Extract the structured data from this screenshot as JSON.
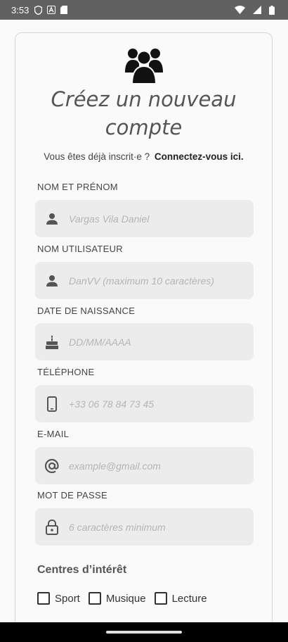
{
  "status_bar": {
    "time": "3:53",
    "icons_left": [
      "shield-icon",
      "a-icon",
      "sd-card-icon"
    ],
    "icons_right": [
      "wifi-icon",
      "signal-icon",
      "battery-icon"
    ]
  },
  "header": {
    "title": "Créez un nouveau compte",
    "subtitle": "Vous êtes déjà inscrit·e ?",
    "login_link": "Connectez-vous ici."
  },
  "fields": {
    "fullname": {
      "label": "NOM ET PRÉNOM",
      "placeholder": "Vargas Vila Daniel",
      "icon": "person-icon"
    },
    "username": {
      "label": "NOM UTILISATEUR",
      "placeholder": "DanVV (maximum 10 caractères)",
      "icon": "person-icon"
    },
    "birthdate": {
      "label": "DATE DE NAISSANCE",
      "placeholder": "DD/MM/AAAA",
      "icon": "cake-icon"
    },
    "phone": {
      "label": "TÉLÉPHONE",
      "placeholder": "+33 06 78 84 73 45",
      "icon": "phone-icon"
    },
    "email": {
      "label": "E-MAIL",
      "placeholder": "example@gmail.com",
      "icon": "at-icon"
    },
    "password": {
      "label": "MOT DE PASSE",
      "placeholder": "6 caractères minimum",
      "icon": "lock-icon"
    }
  },
  "interests": {
    "title": "Centres d’intérêt",
    "options": [
      "Sport",
      "Musique",
      "Lecture"
    ]
  },
  "colors": {
    "field_bg": "#ececec",
    "placeholder": "#b5b5b5",
    "status_bar": "#616161"
  }
}
